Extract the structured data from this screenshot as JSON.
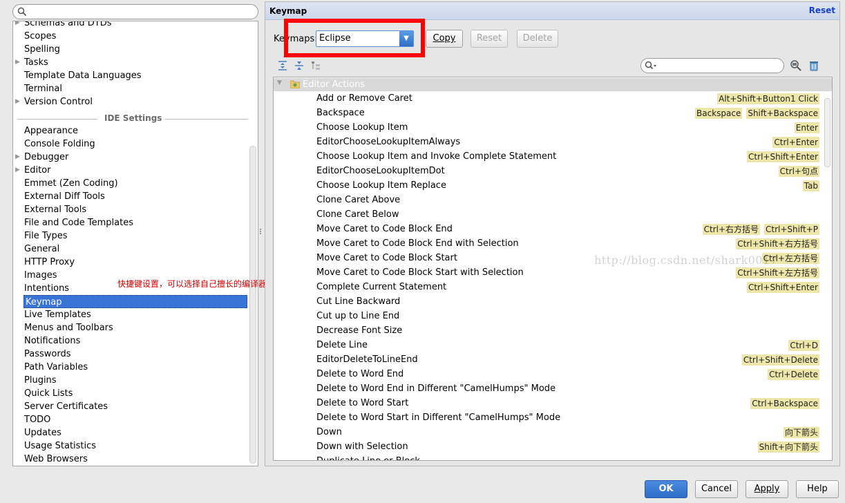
{
  "left": {
    "search": {
      "placeholder": ""
    },
    "items_top": [
      {
        "label": "Schemas and DTDs",
        "arrow": true
      },
      {
        "label": "Scopes",
        "arrow": false
      },
      {
        "label": "Spelling",
        "arrow": false
      },
      {
        "label": "Tasks",
        "arrow": true
      },
      {
        "label": "Template Data Languages",
        "arrow": false
      },
      {
        "label": "Terminal",
        "arrow": false
      },
      {
        "label": "Version Control",
        "arrow": true
      }
    ],
    "section_label": "IDE Settings",
    "items_ide": [
      {
        "label": "Appearance",
        "arrow": false
      },
      {
        "label": "Console Folding",
        "arrow": false
      },
      {
        "label": "Debugger",
        "arrow": true
      },
      {
        "label": "Editor",
        "arrow": true
      },
      {
        "label": "Emmet (Zen Coding)",
        "arrow": false
      },
      {
        "label": "External Diff Tools",
        "arrow": false
      },
      {
        "label": "External Tools",
        "arrow": false
      },
      {
        "label": "File and Code Templates",
        "arrow": false
      },
      {
        "label": "File Types",
        "arrow": false
      },
      {
        "label": "General",
        "arrow": false
      },
      {
        "label": "HTTP Proxy",
        "arrow": false
      },
      {
        "label": "Images",
        "arrow": false
      },
      {
        "label": "Intentions",
        "arrow": false
      },
      {
        "label": "Keymap",
        "arrow": false,
        "selected": true
      },
      {
        "label": "Live Templates",
        "arrow": false
      },
      {
        "label": "Menus and Toolbars",
        "arrow": false
      },
      {
        "label": "Notifications",
        "arrow": false
      },
      {
        "label": "Passwords",
        "arrow": false
      },
      {
        "label": "Path Variables",
        "arrow": false
      },
      {
        "label": "Plugins",
        "arrow": false
      },
      {
        "label": "Quick Lists",
        "arrow": false
      },
      {
        "label": "Server Certificates",
        "arrow": false
      },
      {
        "label": "TODO",
        "arrow": false
      },
      {
        "label": "Updates",
        "arrow": false
      },
      {
        "label": "Usage Statistics",
        "arrow": false
      },
      {
        "label": "Web Browsers",
        "arrow": false
      }
    ]
  },
  "annotation": "快捷键设置，可以选择自己擅长的编译器去修改",
  "header": {
    "title": "Keymap",
    "reset": "Reset"
  },
  "keymap": {
    "label": "Keymaps:",
    "selected": "Eclipse",
    "copy": "Copy",
    "reset": "Reset",
    "delete": "Delete"
  },
  "filter": {
    "placeholder": ""
  },
  "group": "Editor Actions",
  "actions": [
    {
      "name": "Add or Remove Caret",
      "keys": [
        "Alt+Shift+Button1 Click"
      ]
    },
    {
      "name": "Backspace",
      "keys": [
        "Backspace",
        "Shift+Backspace"
      ]
    },
    {
      "name": "Choose Lookup Item",
      "keys": [
        "Enter"
      ]
    },
    {
      "name": "EditorChooseLookupItemAlways",
      "keys": [
        "Ctrl+Enter"
      ]
    },
    {
      "name": "Choose Lookup Item and Invoke Complete Statement",
      "keys": [
        "Ctrl+Shift+Enter"
      ]
    },
    {
      "name": "EditorChooseLookupItemDot",
      "keys": [
        "Ctrl+句点"
      ]
    },
    {
      "name": "Choose Lookup Item Replace",
      "keys": [
        "Tab"
      ]
    },
    {
      "name": "Clone Caret Above",
      "keys": []
    },
    {
      "name": "Clone Caret Below",
      "keys": []
    },
    {
      "name": "Move Caret to Code Block End",
      "keys": [
        "Ctrl+右方括号",
        "Ctrl+Shift+P"
      ]
    },
    {
      "name": "Move Caret to Code Block End with Selection",
      "keys": [
        "Ctrl+Shift+右方括号"
      ]
    },
    {
      "name": "Move Caret to Code Block Start",
      "keys": [
        "Ctrl+左方括号"
      ]
    },
    {
      "name": "Move Caret to Code Block Start with Selection",
      "keys": [
        "Ctrl+Shift+左方括号"
      ]
    },
    {
      "name": "Complete Current Statement",
      "keys": [
        "Ctrl+Shift+Enter"
      ]
    },
    {
      "name": "Cut Line Backward",
      "keys": []
    },
    {
      "name": "Cut up to Line End",
      "keys": []
    },
    {
      "name": "Decrease Font Size",
      "keys": []
    },
    {
      "name": "Delete Line",
      "keys": [
        "Ctrl+D"
      ]
    },
    {
      "name": "EditorDeleteToLineEnd",
      "keys": [
        "Ctrl+Shift+Delete"
      ]
    },
    {
      "name": "Delete to Word End",
      "keys": [
        "Ctrl+Delete"
      ]
    },
    {
      "name": "Delete to Word End in Different \"CamelHumps\" Mode",
      "keys": []
    },
    {
      "name": "Delete to Word Start",
      "keys": [
        "Ctrl+Backspace"
      ]
    },
    {
      "name": "Delete to Word Start in Different \"CamelHumps\" Mode",
      "keys": []
    },
    {
      "name": "Down",
      "keys": [
        "向下箭头"
      ]
    },
    {
      "name": "Down with Selection",
      "keys": [
        "Shift+向下箭头"
      ]
    },
    {
      "name": "Duplicate Line or Block",
      "keys": []
    }
  ],
  "watermark": "http://blog.csdn.net/shark0017",
  "footer": {
    "ok": "OK",
    "cancel": "Cancel",
    "apply": "Apply",
    "help": "Help"
  }
}
